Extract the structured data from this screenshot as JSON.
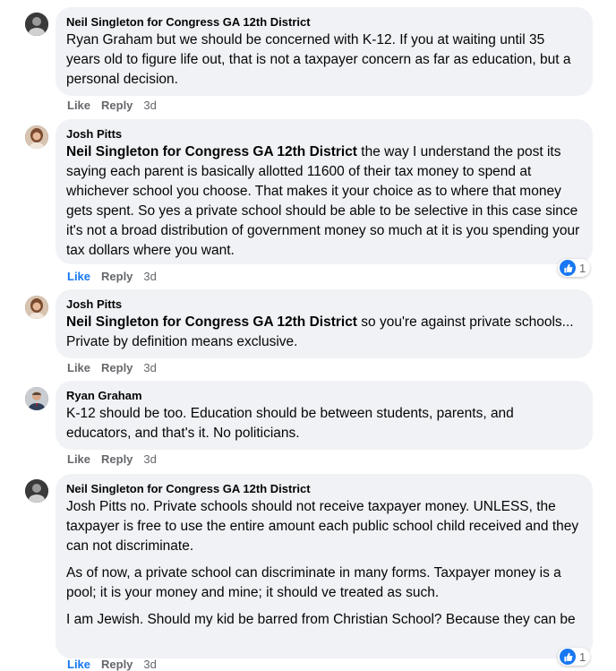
{
  "comments": [
    {
      "author": "Neil Singleton for Congress GA 12th District",
      "mention": "",
      "paragraphs": [
        "Ryan Graham but we should be concerned with K-12. If you at waiting until 35 years old to figure life out, that is not a taxpayer concern as far as education, but a personal decision."
      ],
      "like": "Like",
      "reply": "Reply",
      "time": "3d",
      "reaction_count": ""
    },
    {
      "author": "Josh Pitts",
      "mention": "Neil Singleton for Congress GA 12th District",
      "paragraphs": [
        " the way I understand the post its saying each parent is basically allotted 11600 of their tax money to spend at whichever school you choose. That makes it your choice as to where that money gets spent. So yes a private school should be able to be selective in this case since it's not a broad distribution of government money so much at it is you spending your tax dollars where you want."
      ],
      "like": "Like",
      "reply": "Reply",
      "time": "3d",
      "reaction_count": "1"
    },
    {
      "author": "Josh Pitts",
      "mention": "Neil Singleton for Congress GA 12th District",
      "paragraphs": [
        " so you're against private schools... Private by definition means exclusive."
      ],
      "like": "Like",
      "reply": "Reply",
      "time": "3d",
      "reaction_count": ""
    },
    {
      "author": "Ryan Graham",
      "mention": "",
      "paragraphs": [
        "K-12 should be too. Education should be between students, parents, and educators, and that's it. No politicians."
      ],
      "like": "Like",
      "reply": "Reply",
      "time": "3d",
      "reaction_count": ""
    },
    {
      "author": "Neil Singleton for Congress GA 12th District",
      "mention": "",
      "paragraphs": [
        "Josh Pitts no. Private schools should not receive taxpayer money. UNLESS, the taxpayer is free to use the entire amount each public school child received and they can not discriminate.",
        "As of now, a private school can discriminate in many forms. Taxpayer money is a pool; it is your money and mine; it should ve treated as such.",
        "I am Jewish. Should my kid be barred from Christian School? Because they can be"
      ],
      "like": "Like",
      "reply": "Reply",
      "time": "3d",
      "reaction_count": "1"
    }
  ],
  "colors": {
    "accent": "#1877f2",
    "bubble": "#f0f2f5",
    "meta": "#65676b"
  },
  "icons": {
    "reaction": "like-thumb-icon"
  }
}
